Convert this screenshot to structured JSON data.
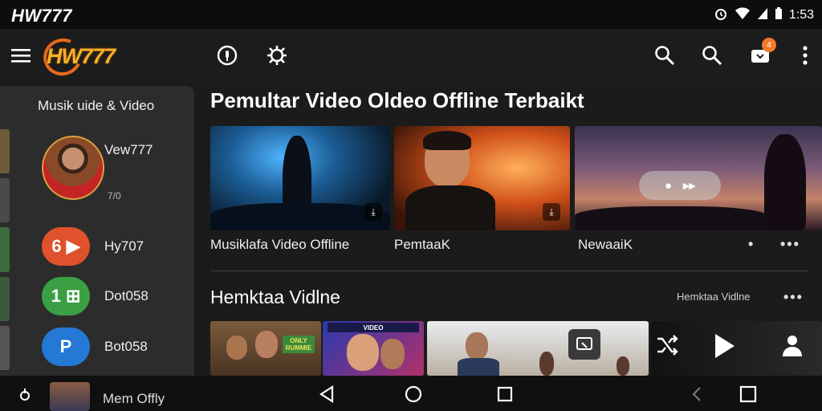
{
  "status_bar": {
    "title": "HW777",
    "time": "1:53"
  },
  "app_bar": {
    "logo_text": "HW777",
    "badge_text": "4"
  },
  "sidebar": {
    "heading": "Musik uide & Video",
    "profile": {
      "name": "Vew777",
      "sub": "7/0"
    },
    "items": [
      {
        "avatar_text": "6 ▶",
        "label": "Hy707",
        "color": "#e0522b"
      },
      {
        "avatar_text": "1 ⊞",
        "label": "Dot058",
        "color": "#3aa043"
      },
      {
        "avatar_text": "P",
        "label": "Bot058",
        "color": "#2478d6"
      }
    ]
  },
  "main": {
    "section1_title": "Pemultar Video Oldeo Offline Terbaikt",
    "cards1": [
      {
        "label": "Musiklafa Video Offline"
      },
      {
        "label": "PemtaaK"
      },
      {
        "label": "NewaaiK"
      }
    ],
    "section2_title": "Hemktaa Vidlne",
    "section2_more": "Hemktaa Vidlne",
    "cards2": [
      {
        "poster_text": "ONLY RUMMIE"
      },
      {
        "poster_text": "VIDEO"
      },
      {
        "poster_text": ""
      }
    ]
  },
  "bottom_bar": {
    "now_playing": "Mem Offly"
  },
  "colors": {
    "accent": "#f37a2a",
    "logo": "#f6b12a",
    "background": "#1b1b1b"
  }
}
